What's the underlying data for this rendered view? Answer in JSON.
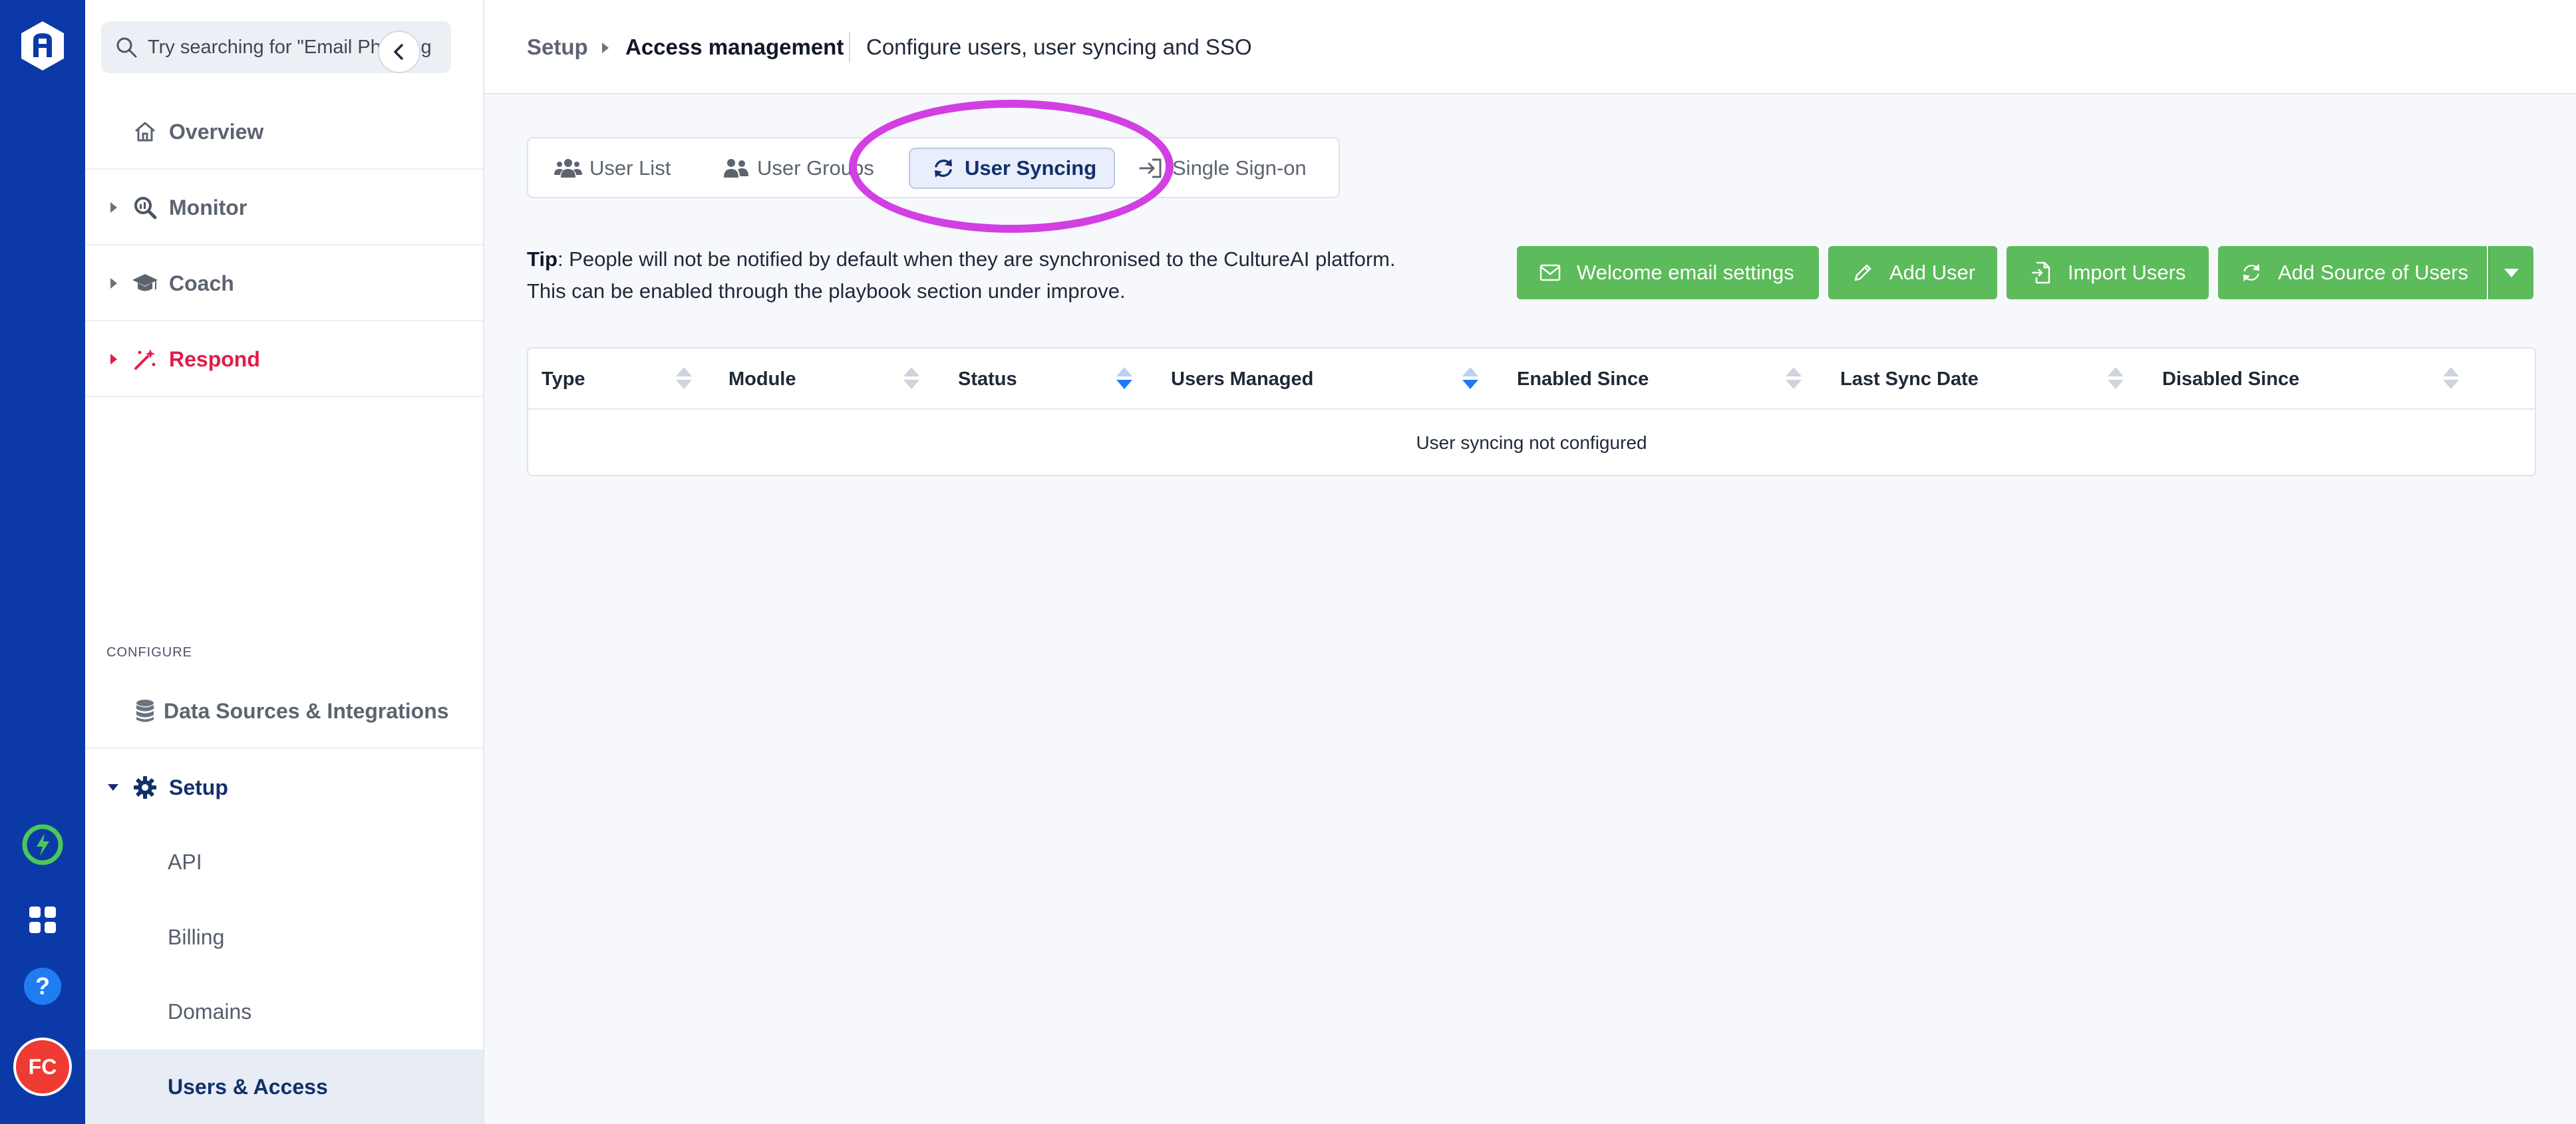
{
  "app": {
    "brand_color": "#0b3aa8",
    "accent_green": "#5cbb5a",
    "highlight_color": "#d23fe3",
    "user_initials": "FC"
  },
  "search": {
    "placeholder": "Try searching for \"Email Phishing\""
  },
  "sidebar": {
    "items": [
      {
        "label": "Overview",
        "icon": "home-icon"
      },
      {
        "label": "Monitor",
        "icon": "monitor-search-icon"
      },
      {
        "label": "Coach",
        "icon": "graduation-cap-icon"
      },
      {
        "label": "Respond",
        "icon": "magic-wand-icon"
      }
    ],
    "section_label": "CONFIGURE",
    "configure_items": [
      {
        "label": "Data Sources & Integrations",
        "icon": "database-icon"
      },
      {
        "label": "Setup",
        "icon": "gear-icon"
      }
    ],
    "setup_subitems": [
      {
        "label": "API"
      },
      {
        "label": "Billing"
      },
      {
        "label": "Domains"
      },
      {
        "label": "Users & Access",
        "active": true
      }
    ]
  },
  "header": {
    "breadcrumb_root": "Setup",
    "breadcrumb_current": "Access management",
    "description": "Configure users, user syncing and SSO"
  },
  "tabs": [
    {
      "label": "User List",
      "icon": "users-icon"
    },
    {
      "label": "User Groups",
      "icon": "user-group-icon"
    },
    {
      "label": "User Syncing",
      "icon": "sync-icon",
      "active": true
    },
    {
      "label": "Single Sign-on",
      "icon": "sign-in-icon"
    }
  ],
  "tip": {
    "prefix": "Tip",
    "line1": ": People will not be notified by default when they are synchronised to the CultureAI platform.",
    "line2": "This can be enabled through the playbook section under improve."
  },
  "actions": {
    "welcome": "Welcome email settings",
    "add_user": "Add User",
    "import_users": "Import Users",
    "add_source": "Add Source of Users"
  },
  "table": {
    "columns": [
      "Type",
      "Module",
      "Status",
      "Users Managed",
      "Enabled Since",
      "Last Sync Date",
      "Disabled Since"
    ],
    "active_sort_columns": [
      "Status",
      "Users Managed"
    ],
    "empty_message": "User syncing not configured"
  }
}
